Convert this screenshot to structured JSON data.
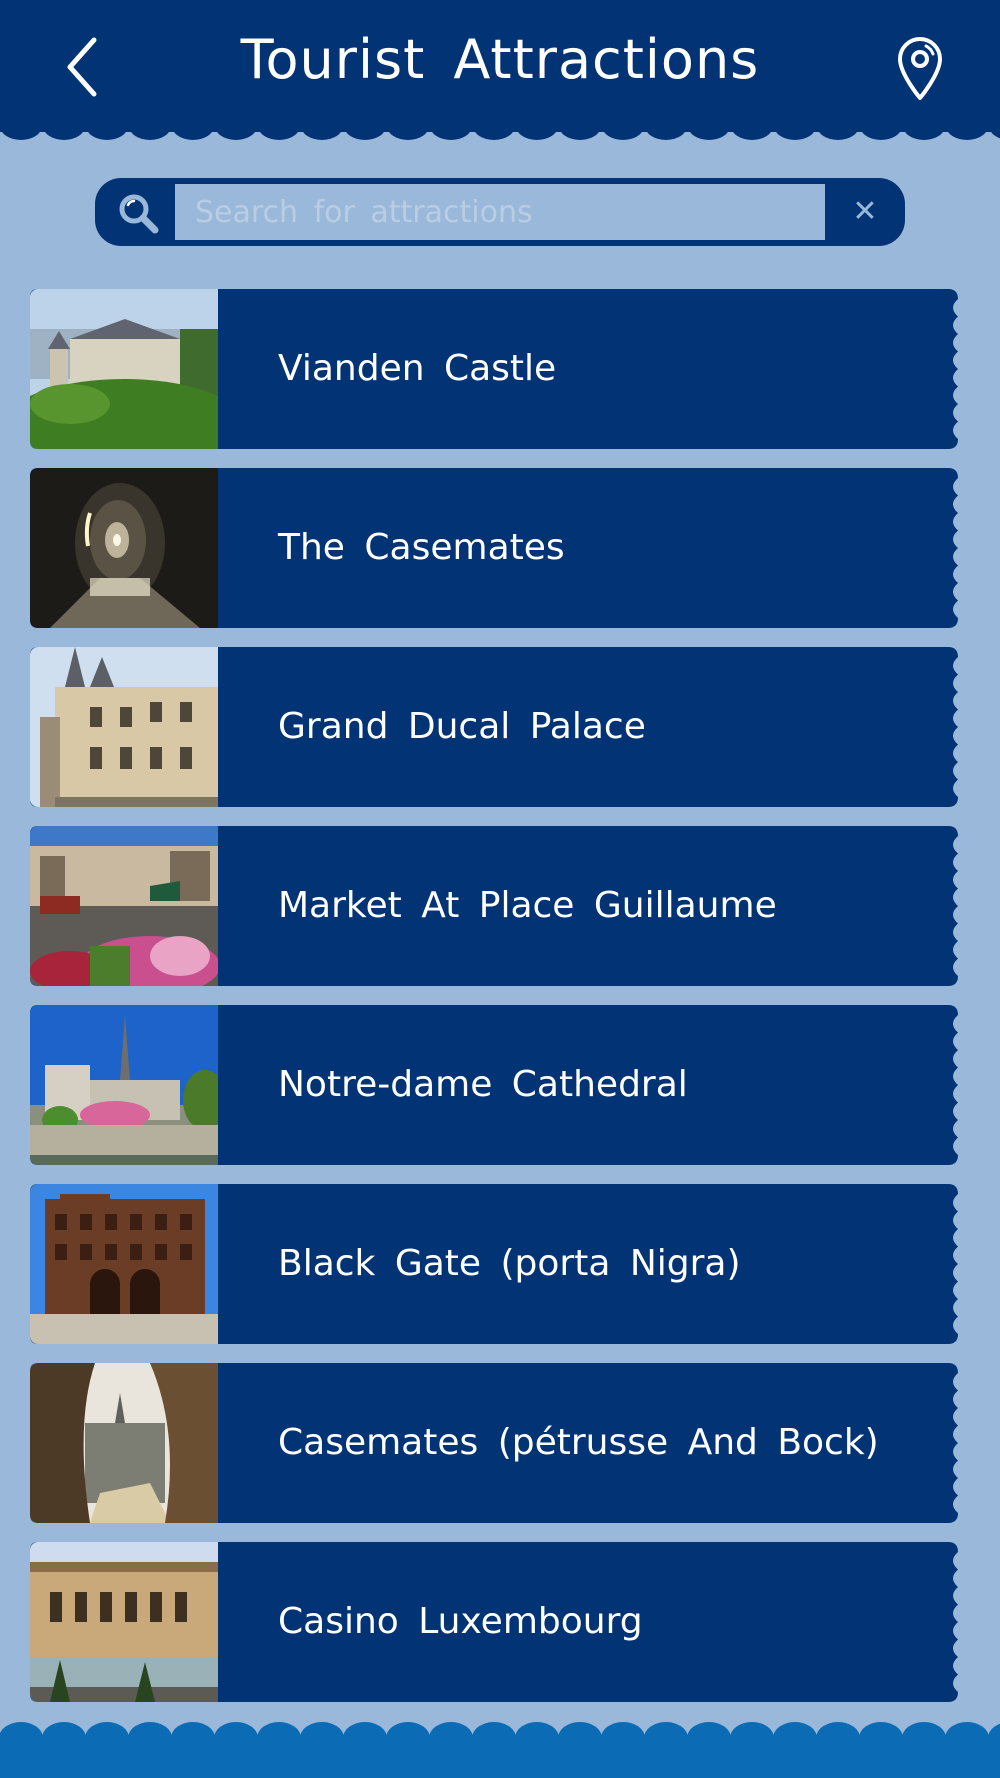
{
  "header": {
    "title": "Tourist Attractions",
    "back_icon": "chevron-left-icon",
    "location_icon": "map-pin-icon"
  },
  "search": {
    "placeholder": "Search for attractions",
    "value": "",
    "search_icon": "magnifier-icon",
    "clear_label": "✕"
  },
  "attractions": [
    {
      "name": "Vianden Castle"
    },
    {
      "name": "The Casemates"
    },
    {
      "name": "Grand Ducal Palace"
    },
    {
      "name": "Market At Place Guillaume"
    },
    {
      "name": "Notre-dame Cathedral"
    },
    {
      "name": "Black Gate (porta Nigra)"
    },
    {
      "name": "Casemates (pétrusse And Bock)"
    },
    {
      "name": "Casino Luxembourg"
    }
  ],
  "colors": {
    "primary": "#023375",
    "background": "#9ab8d9",
    "footer": "#0b6bb5",
    "text": "#ffffff"
  }
}
